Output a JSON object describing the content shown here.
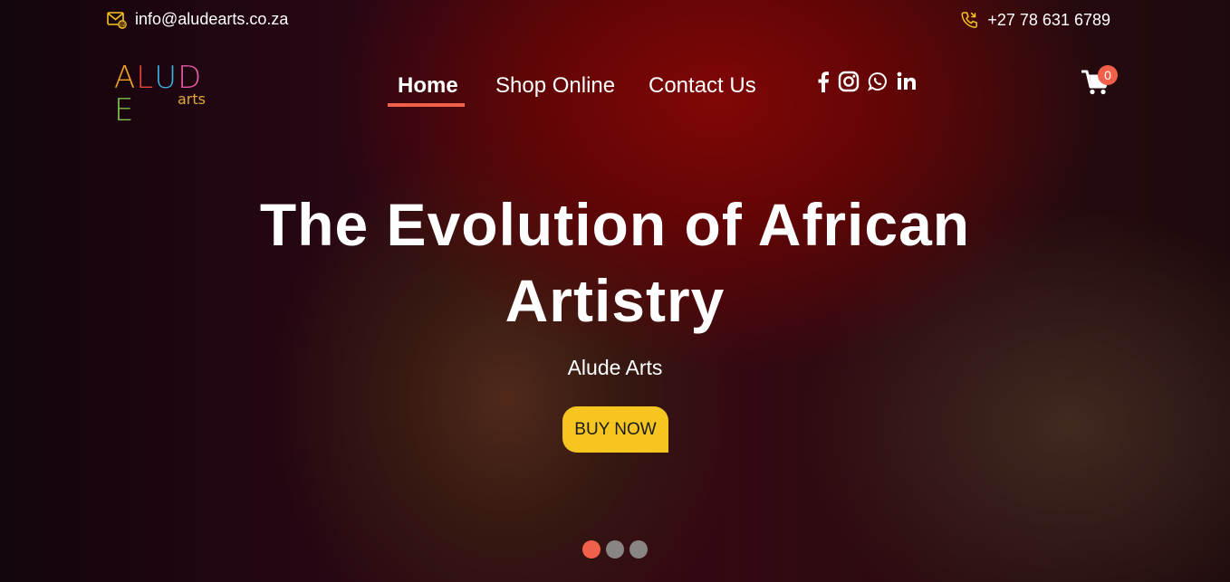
{
  "topbar": {
    "email": "info@aludearts.co.za",
    "phone": "+27 78 631 6789",
    "email_icon": "mail-icon",
    "phone_icon": "phone-icon"
  },
  "logo": {
    "letters": [
      "A",
      "L",
      "U",
      "D",
      "E"
    ],
    "letter_colors": [
      "#f2a02a",
      "#e8443c",
      "#3fb0e0",
      "#e85aa8",
      "#7ec04a"
    ],
    "sub": "arts"
  },
  "nav": {
    "items": [
      {
        "label": "Home",
        "active": true
      },
      {
        "label": "Shop Online",
        "active": false
      },
      {
        "label": "Contact Us",
        "active": false
      }
    ]
  },
  "socials": [
    "facebook-icon",
    "instagram-icon",
    "whatsapp-icon",
    "linkedin-icon"
  ],
  "cart": {
    "count": "0",
    "icon": "cart-icon"
  },
  "hero": {
    "headline_line1": "The Evolution of African",
    "headline_line2": "Artistry",
    "subtitle": "Alude Arts",
    "cta": "BUY NOW"
  },
  "carousel": {
    "slides": 3,
    "active_index": 0
  },
  "colors": {
    "accent": "#f0604a",
    "button": "#f6c520",
    "icon_gold": "#f6c520"
  }
}
